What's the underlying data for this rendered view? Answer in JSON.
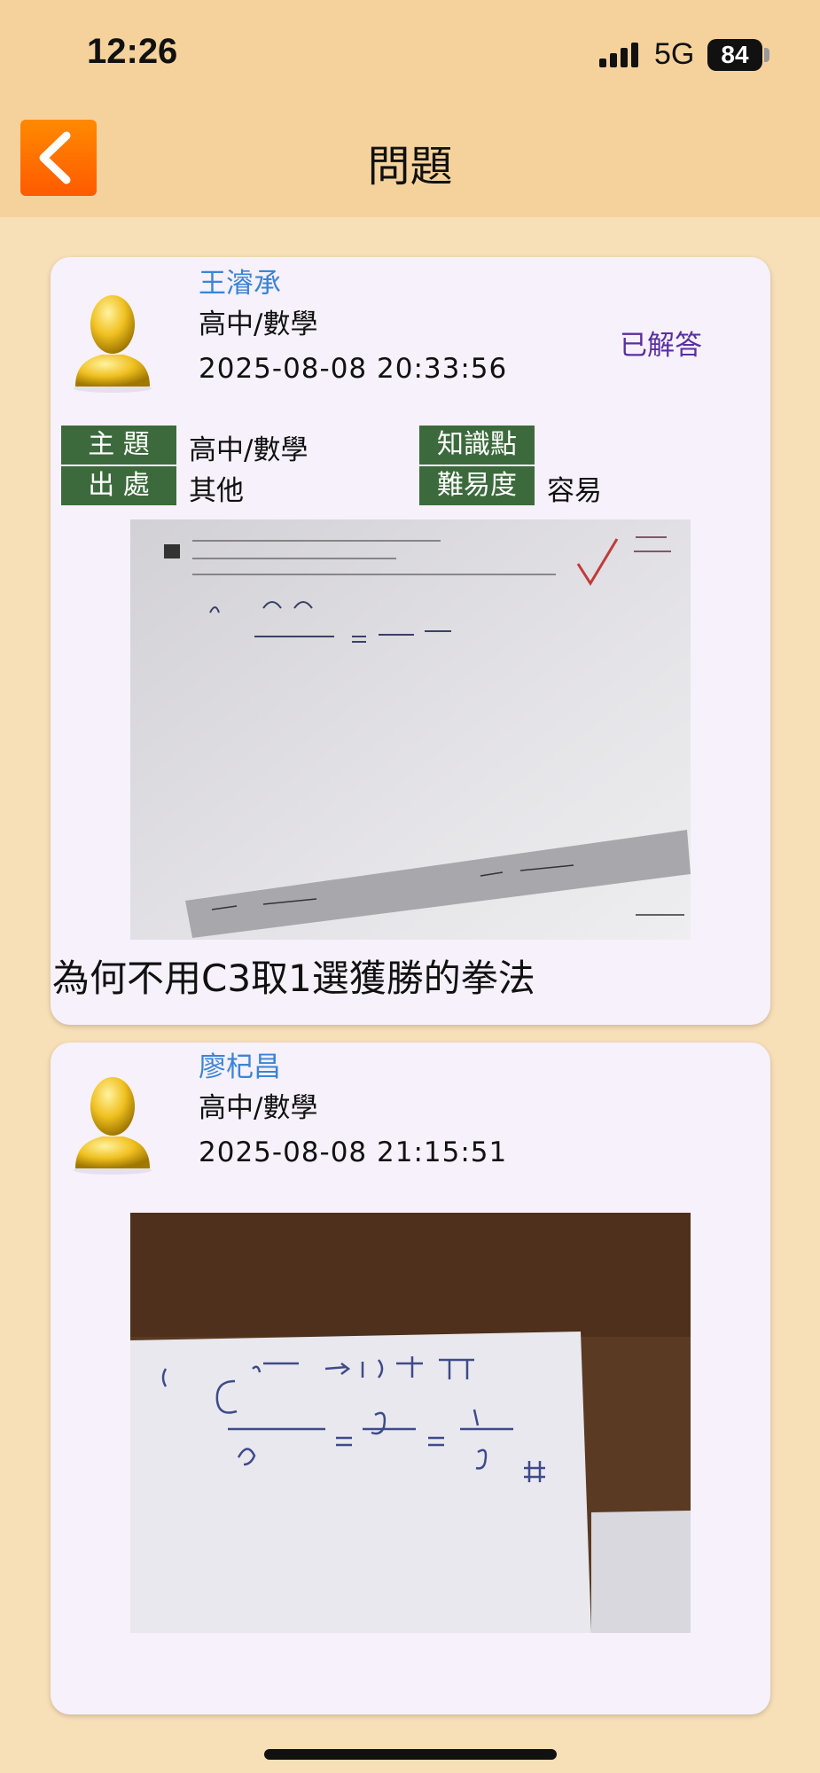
{
  "status_bar": {
    "time": "12:26",
    "network": "5G",
    "battery": "84"
  },
  "header": {
    "title": "問題"
  },
  "posts": [
    {
      "user": "王濬承",
      "subject": "高中/數學",
      "datetime": "2025-08-08 20:33:56",
      "status": "已解答",
      "tags": {
        "topic_label": "主 題",
        "topic_value": "高中/數學",
        "source_label": "出 處",
        "source_value": "其他",
        "knowledge_label": "知識點",
        "knowledge_value": "",
        "difficulty_label": "難易度",
        "difficulty_value": "容易"
      },
      "question": "為何不用C3取1選獲勝的拳法"
    },
    {
      "user": "廖杞昌",
      "subject": "高中/數學",
      "datetime": "2025-08-08 21:15:51"
    }
  ],
  "colors": {
    "header_bg": "#f5d29c",
    "page_bg": "#f7dfb7",
    "card_bg": "#f6f1fb",
    "user_blue": "#3b84d6",
    "tag_green": "#3c6a3c",
    "status_purple": "#5a2fa0",
    "back_orange": "#ff6a00"
  },
  "icons": {
    "back": "chevron-left-icon",
    "avatar": "person-avatar-icon"
  }
}
